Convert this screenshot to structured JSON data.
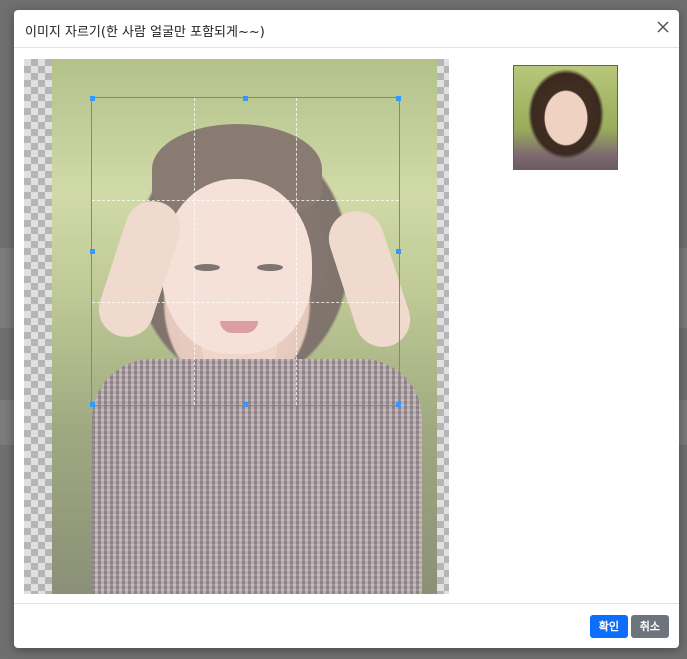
{
  "modal": {
    "title": "이미지 자르기(한 사람 얼굴만 포함되게~~)",
    "confirm_label": "확인",
    "cancel_label": "취소"
  },
  "icons": {
    "close": "close-icon"
  },
  "colors": {
    "crop_outline": "#3399ff",
    "preview_border": "#c0392b",
    "confirm_button": "#0d6efd",
    "cancel_button": "#6c757d"
  }
}
